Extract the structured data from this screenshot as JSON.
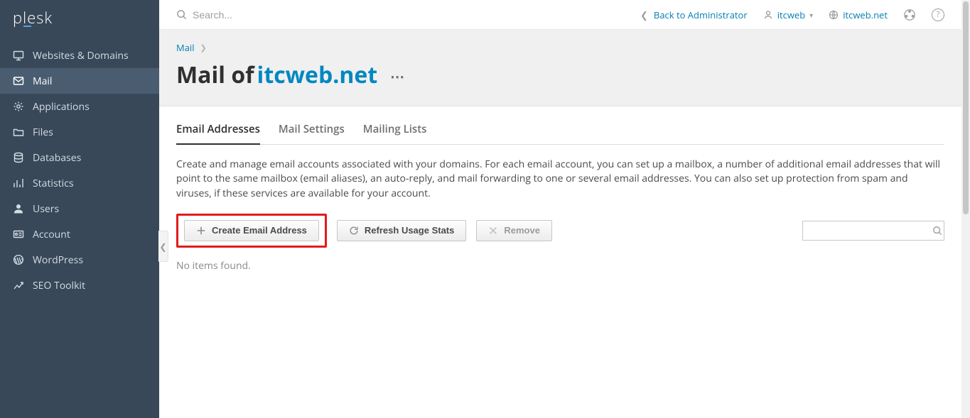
{
  "brand": "plesk",
  "topbar": {
    "search_placeholder": "Search...",
    "back_link": "Back to Administrator",
    "user_name": "itcweb",
    "site_name": "itcweb.net"
  },
  "sidebar": {
    "items": [
      {
        "label": "Websites & Domains"
      },
      {
        "label": "Mail"
      },
      {
        "label": "Applications"
      },
      {
        "label": "Files"
      },
      {
        "label": "Databases"
      },
      {
        "label": "Statistics"
      },
      {
        "label": "Users"
      },
      {
        "label": "Account"
      },
      {
        "label": "WordPress"
      },
      {
        "label": "SEO Toolkit"
      }
    ],
    "active_index": 1
  },
  "breadcrumb": {
    "root": "Mail"
  },
  "page_title": {
    "prefix": "Mail of ",
    "domain": "itcweb.net"
  },
  "tabs": [
    {
      "label": "Email Addresses"
    },
    {
      "label": "Mail Settings"
    },
    {
      "label": "Mailing Lists"
    }
  ],
  "active_tab_index": 0,
  "description": "Create and manage email accounts associated with your domains. For each email account, you can set up a mailbox, a number of additional email addresses that will point to the same mailbox (email aliases), an auto-reply, and mail forwarding to one or several email addresses. You can also set up protection from spam and viruses, if these services are available for your account.",
  "buttons": {
    "create": "Create Email Address",
    "refresh": "Refresh Usage Stats",
    "remove": "Remove"
  },
  "empty_message": "No items found.",
  "colors": {
    "accent": "#007eb0",
    "sidebar_bg": "#384859",
    "sidebar_active": "#4a5d70",
    "highlight_border": "#e11b1b"
  }
}
